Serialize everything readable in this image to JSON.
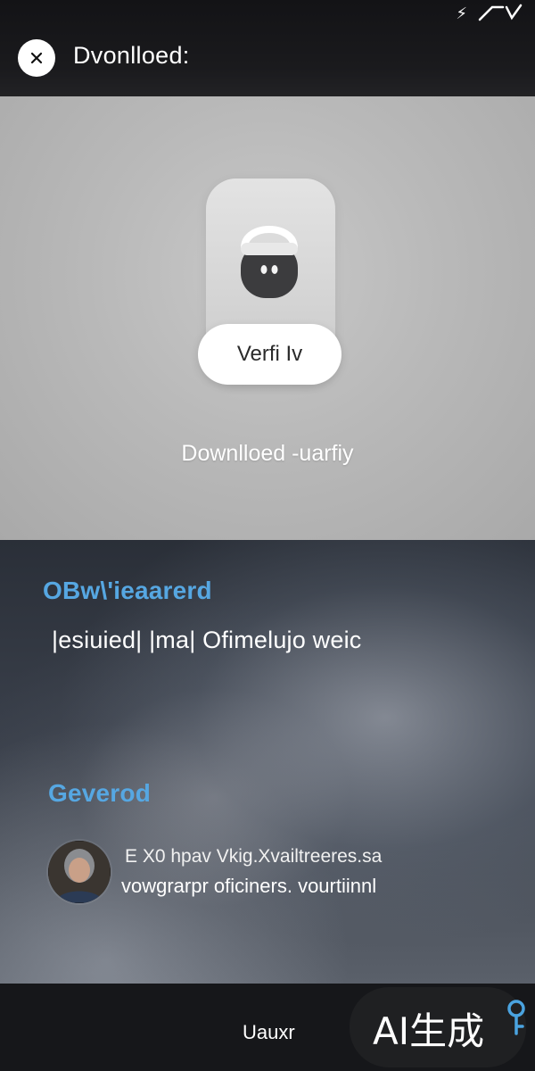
{
  "header": {
    "title": "Dvonlloed:",
    "status_glyph": "⚡"
  },
  "panel": {
    "verify_label": "Verfi Iv",
    "caption": "Downlloed -uarfiy"
  },
  "content": {
    "heading1": "OBw\\'ieaarerd",
    "subline": "|esiuied| |ma| Ofimelujo  weic",
    "heading2": "Geverod",
    "comment_line1": "E X0 hpav Vkig.Xvailtreeres.sa",
    "comment_line2": "vowgrarpr oficiners. vourtiinnl"
  },
  "footer": {
    "label": "Uauxr",
    "watermark": "AI生成"
  },
  "colors": {
    "accent": "#56a7e2",
    "panel_gray": "#b9b9b9",
    "bar_dark": "#16171a"
  }
}
